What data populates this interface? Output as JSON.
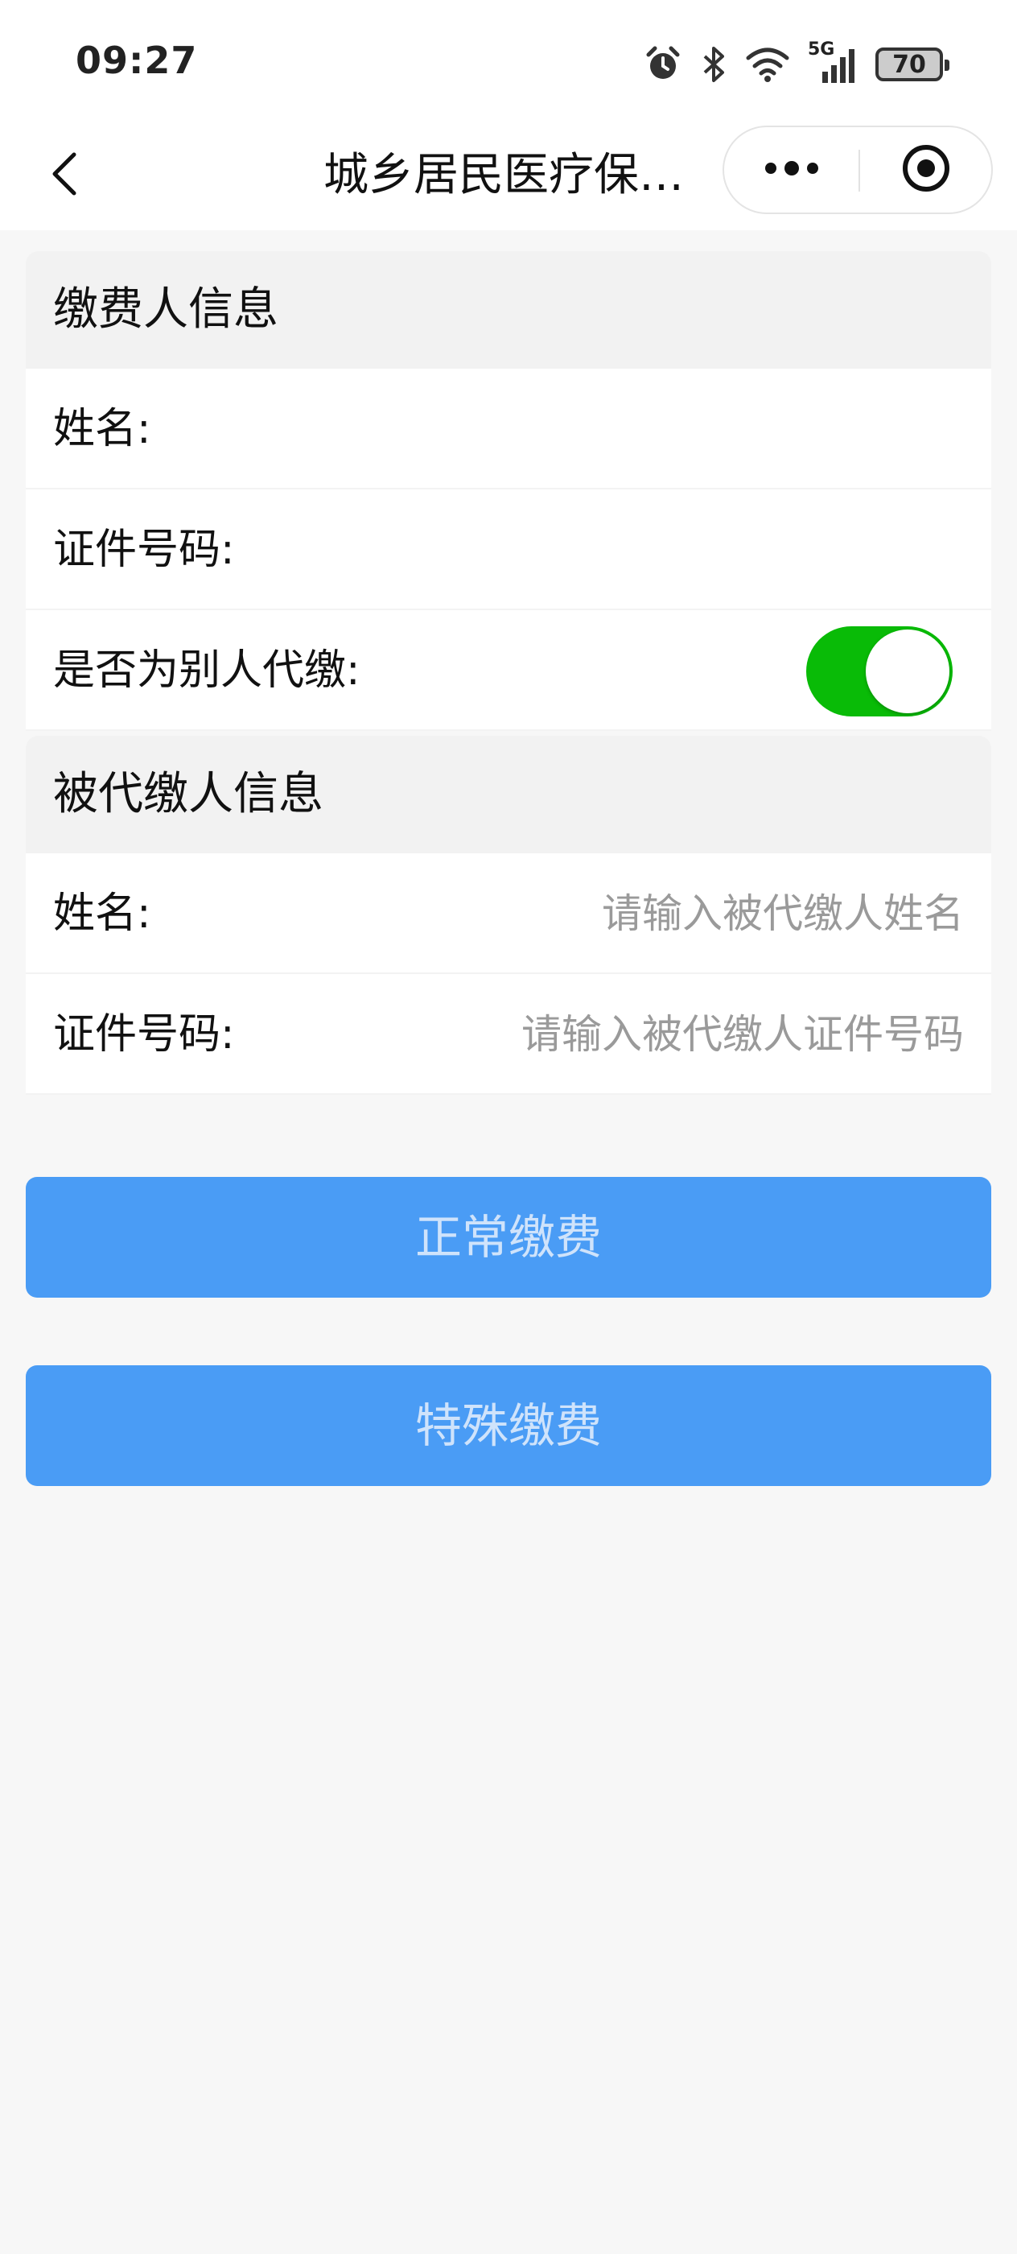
{
  "status_bar": {
    "time": "09:27",
    "network": "5G",
    "battery": "70",
    "icons": [
      "alarm-icon",
      "bluetooth-icon",
      "wifi-icon",
      "signal-icon",
      "battery-icon"
    ]
  },
  "nav": {
    "title": "城乡居民医疗保…",
    "icons": [
      "chevron-left-icon",
      "more-icon",
      "close-target-icon"
    ]
  },
  "payer_section": {
    "title": "缴费人信息",
    "name_label": "姓名:",
    "name_value": "",
    "id_label": "证件号码:",
    "id_value": "",
    "proxy_label": "是否为别人代缴:",
    "proxy_enabled": true
  },
  "beneficiary_section": {
    "title": "被代缴人信息",
    "name_label": "姓名:",
    "name_placeholder": "请输入被代缴人姓名",
    "id_label": "证件号码:",
    "id_placeholder": "请输入被代缴人证件号码"
  },
  "buttons": {
    "normal_payment": "正常缴费",
    "special_payment": "特殊缴费"
  },
  "colors": {
    "primary_button": "#4a9cf5",
    "toggle_on": "#09bb07",
    "placeholder": "#9a9a9a"
  }
}
